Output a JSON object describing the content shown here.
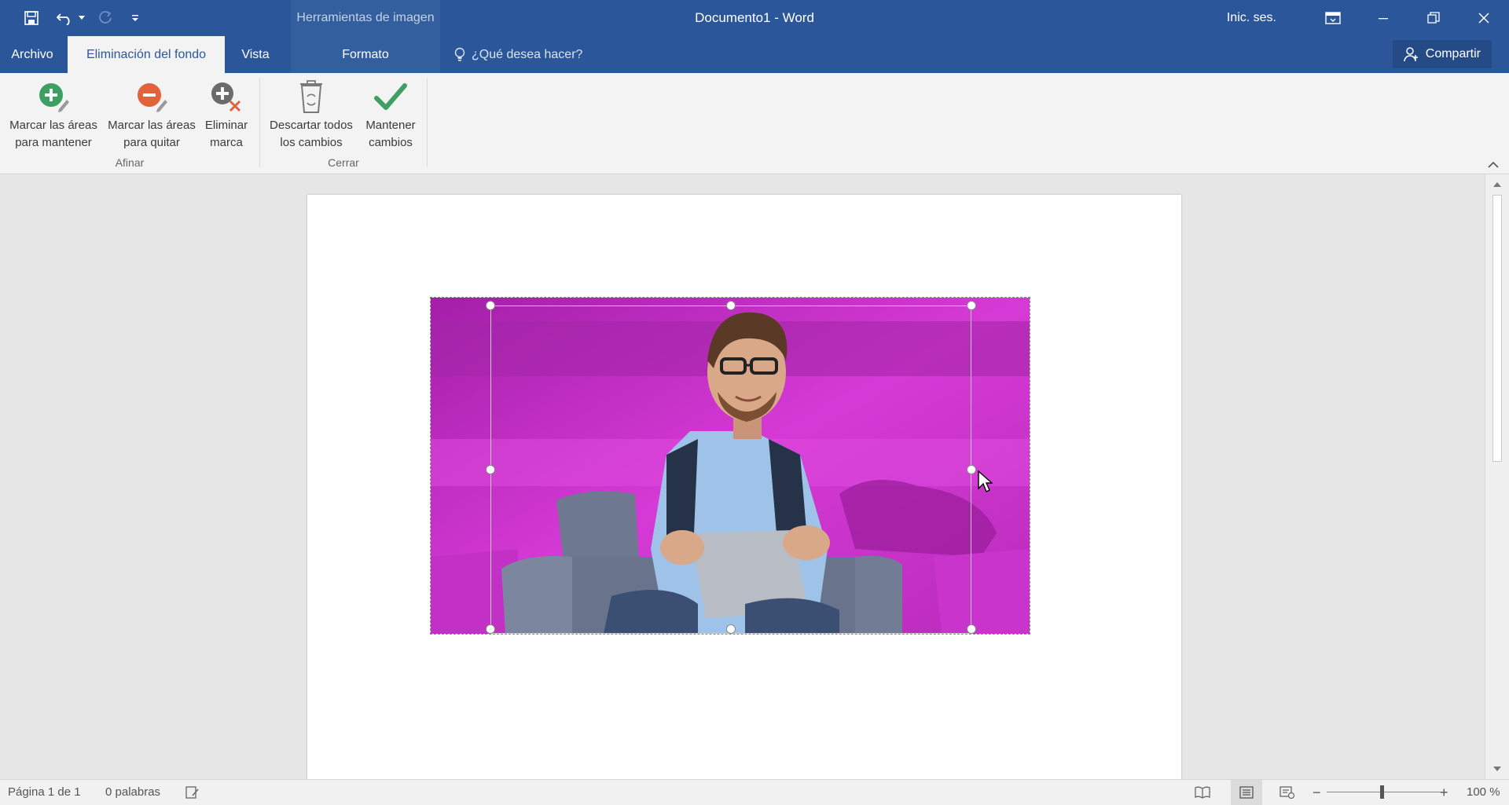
{
  "app": {
    "context_group": "Herramientas de imagen",
    "document_title": "Documento1  -  Word",
    "sign_in": "Inic. ses.",
    "share": "Compartir",
    "accent": "#2b579a"
  },
  "tabs": [
    {
      "label": "Archivo",
      "active": false
    },
    {
      "label": "Eliminación del fondo",
      "active": true
    },
    {
      "label": "Vista",
      "active": false
    },
    {
      "label": "Formato",
      "active": false
    }
  ],
  "tell_me": "¿Qué desea hacer?",
  "ribbon": {
    "groups": [
      {
        "label": "Afinar"
      },
      {
        "label": "Cerrar"
      }
    ],
    "buttons": [
      {
        "label": "Marcar las áreas\npara mantener",
        "icon": "add-mark-icon"
      },
      {
        "label": "Marcar las áreas\npara quitar",
        "icon": "remove-mark-icon"
      },
      {
        "label": "Eliminar\nmarca",
        "icon": "delete-mark-icon"
      },
      {
        "label": "Descartar todos\nlos cambios",
        "icon": "recycle-bin-icon"
      },
      {
        "label": "Mantener\ncambios",
        "icon": "checkmark-icon"
      }
    ]
  },
  "document": {
    "image_description_colors": {
      "removal_overlay": "#d63ad6"
    }
  },
  "status": {
    "page": "Página 1 de 1",
    "words": "0 palabras",
    "zoom": "100 %",
    "zoom_level": 1.0
  }
}
